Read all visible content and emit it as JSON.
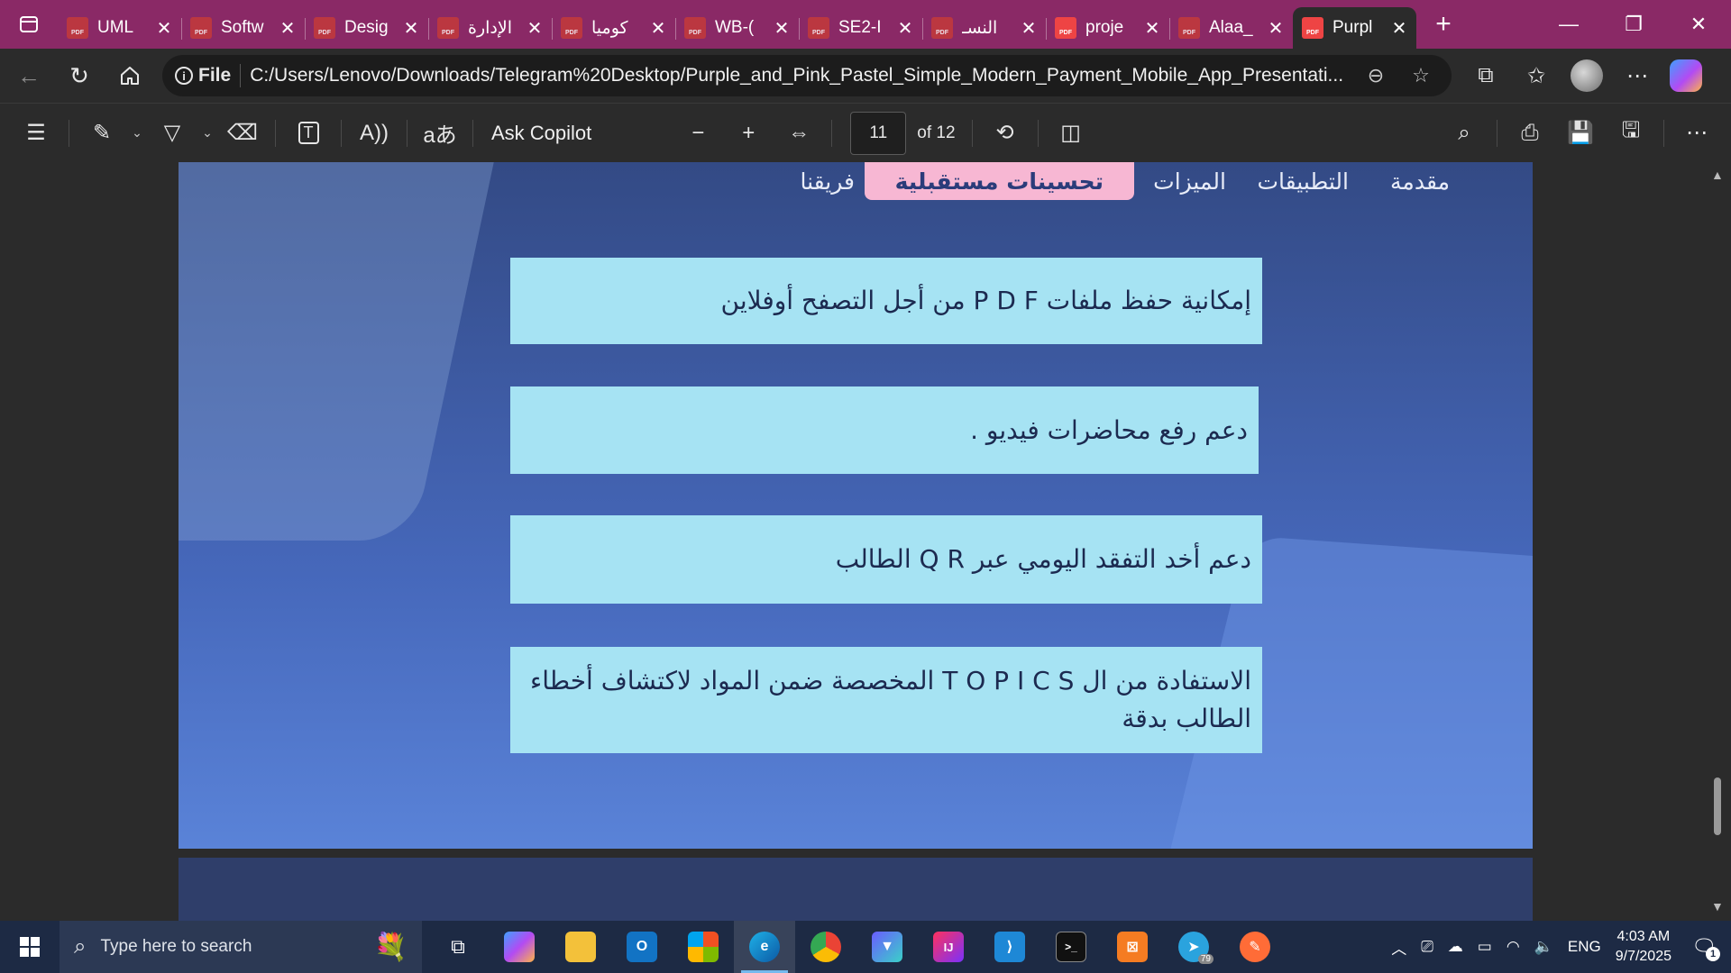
{
  "browser": {
    "tabs": [
      {
        "title": "UML"
      },
      {
        "title": "Softw"
      },
      {
        "title": "Desig"
      },
      {
        "title": "الإدارة"
      },
      {
        "title": "كوميا"
      },
      {
        "title": "WB-("
      },
      {
        "title": "SE2-I"
      },
      {
        "title": "النسـ"
      },
      {
        "title": "proje"
      },
      {
        "title": "Alaa_"
      },
      {
        "title": "Purpl"
      }
    ],
    "address": {
      "scheme_label": "File",
      "url": "C:/Users/Lenovo/Downloads/Telegram%20Desktop/Purple_and_Pink_Pastel_Simple_Modern_Payment_Mobile_App_Presentati..."
    }
  },
  "pdf_toolbar": {
    "ask_copilot": "Ask Copilot",
    "page_number": "11",
    "page_count": "of 12"
  },
  "slide": {
    "nav": {
      "intro": "مقدمة",
      "apps": "التطبيقات",
      "features": "الميزات",
      "future": "تحسينات مستقبلية",
      "team": "فريقنا"
    },
    "items": [
      "إمكانية حفظ ملفات  P D F  من أجل التصفح أوفلاين",
      "دعم رفع محاضرات فيديو .",
      "دعم أخد التفقد اليومي عبر  Q R  الطالب",
      "الاستفادة من ال  T O P I C S  المخصصة ضمن المواد لاكتشاف أخطاء الطالب بدقة"
    ]
  },
  "taskbar": {
    "search_placeholder": "Type here to search",
    "language": "ENG",
    "time": "4:03 AM",
    "date": "9/7/2025",
    "notification_count": "1",
    "telegram_badge": "79"
  },
  "colors": {
    "tabstrip": "#8a2966",
    "slide_top": "#334a85",
    "slide_bottom": "#5a83d8",
    "card": "#a6e3f3",
    "active_nav": "#f7b7d3"
  }
}
